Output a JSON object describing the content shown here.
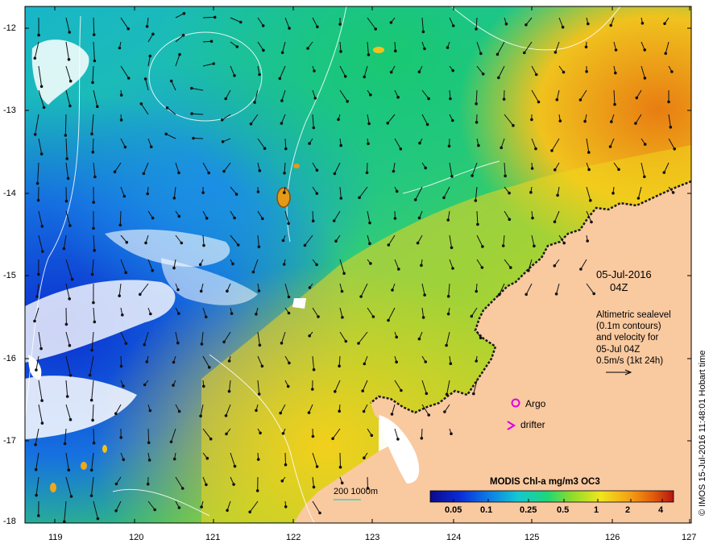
{
  "map": {
    "date_label": "05-Jul-2016",
    "time_label": "04Z",
    "info_lines": [
      "Altimetric sealevel",
      "(0.1m contours)",
      "and velocity for",
      "05-Jul 04Z",
      "0.5m/s (1kt 24h)"
    ],
    "legend": {
      "argo_label": "Argo",
      "drifter_label": "drifter",
      "argo_color": "#e000e0",
      "drifter_color": "#e000e0"
    },
    "depth_scale_label": "200  1000m",
    "colorbar": {
      "title": "MODIS Chl-a mg/m3 OC3",
      "tick_labels": [
        "0.05",
        "0.1",
        "0.25",
        "0.5",
        "1",
        "2",
        "4"
      ],
      "colors": [
        "#0a0a8c",
        "#0a2bd8",
        "#0d7ce6",
        "#14c8d2",
        "#1ed67a",
        "#8cdc2a",
        "#f0e61e",
        "#f5a014",
        "#e05a0a",
        "#b41414"
      ]
    },
    "credit": "© IMOS 15-Jul-2016 11:48:01 Hobart time",
    "lat_labels": [
      "-12",
      "-13",
      "-14",
      "-15",
      "-16",
      "-17",
      "-18"
    ],
    "lon_labels": [
      "119",
      "120",
      "121",
      "122",
      "123",
      "124",
      "125",
      "126",
      "127"
    ],
    "land_color": "#f9c9a0",
    "background_color": "#ffffff"
  }
}
